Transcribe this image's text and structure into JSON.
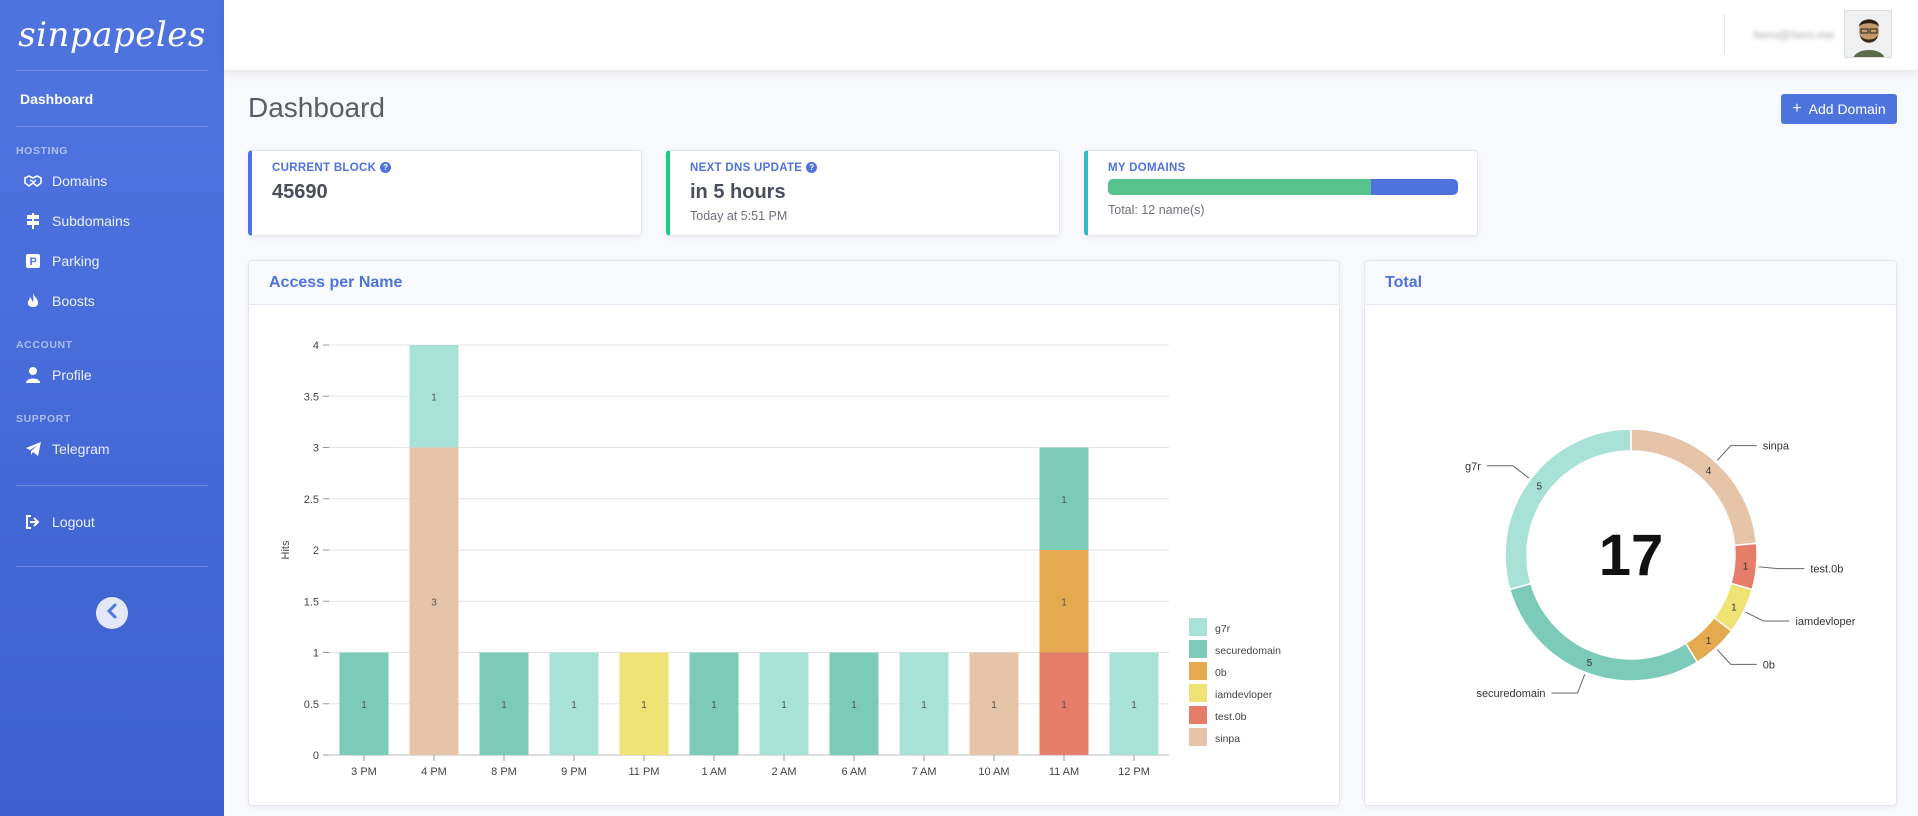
{
  "sidebar": {
    "brand": "sinpapeles",
    "dashboard": "Dashboard",
    "sections": [
      {
        "heading": "HOSTING",
        "items": [
          {
            "label": "Domains",
            "icon": "handshake-icon"
          },
          {
            "label": "Subdomains",
            "icon": "signs-icon"
          },
          {
            "label": "Parking",
            "icon": "parking-icon"
          },
          {
            "label": "Boosts",
            "icon": "flame-icon"
          }
        ]
      },
      {
        "heading": "ACCOUNT",
        "items": [
          {
            "label": "Profile",
            "icon": "user-icon"
          }
        ]
      },
      {
        "heading": "SUPPORT",
        "items": [
          {
            "label": "Telegram",
            "icon": "paper-plane-icon"
          }
        ]
      }
    ],
    "logout": "Logout"
  },
  "topbar": {
    "user": "hero@hero.me"
  },
  "page": {
    "title": "Dashboard",
    "add_button": "Add Domain"
  },
  "stats": {
    "current_block": {
      "label": "CURRENT BLOCK",
      "value": "45690",
      "color": "#4e73df"
    },
    "next_dns": {
      "label": "NEXT DNS UPDATE",
      "value": "in 5 hours",
      "sub": "Today at 5:51 PM",
      "color": "#1cc88a"
    },
    "my_domains": {
      "label": "MY DOMAINS",
      "progress": 0.75,
      "sub": "Total: 12 name(s)",
      "color": "#36b9cc"
    }
  },
  "access_card": {
    "title": "Access per Name"
  },
  "total_card": {
    "title": "Total"
  },
  "chart_data": [
    {
      "type": "bar",
      "stacked": true,
      "ylabel": "Hits",
      "ylim": [
        0,
        4
      ],
      "yticks": [
        "0",
        "0.5",
        "1",
        "1.5",
        "2",
        "2.5",
        "3",
        "3.5",
        "4"
      ],
      "categories": [
        "3 PM",
        "4 PM",
        "8 PM",
        "9 PM",
        "11 PM",
        "1 AM",
        "2 AM",
        "6 AM",
        "7 AM",
        "10 AM",
        "11 AM",
        "12 PM"
      ],
      "legend_position": "right",
      "series": [
        {
          "name": "g7r",
          "color": "#a8e2d6",
          "values": [
            0,
            1,
            0,
            1,
            0,
            0,
            1,
            0,
            1,
            0,
            0,
            1
          ]
        },
        {
          "name": "securedomain",
          "color": "#7ccbb9",
          "values": [
            1,
            0,
            1,
            0,
            0,
            1,
            0,
            1,
            0,
            0,
            1,
            0
          ]
        },
        {
          "name": "0b",
          "color": "#e5aa4f",
          "values": [
            0,
            0,
            0,
            0,
            0,
            0,
            0,
            0,
            0,
            0,
            1,
            0
          ]
        },
        {
          "name": "iamdevloper",
          "color": "#eee374",
          "values": [
            0,
            0,
            0,
            0,
            1,
            0,
            0,
            0,
            0,
            0,
            0,
            0
          ]
        },
        {
          "name": "test.0b",
          "color": "#e67c6a",
          "values": [
            0,
            0,
            0,
            0,
            0,
            0,
            0,
            0,
            0,
            0,
            1,
            0
          ]
        },
        {
          "name": "sinpa",
          "color": "#e5c4a7",
          "values": [
            0,
            3,
            0,
            0,
            0,
            0,
            0,
            0,
            0,
            1,
            0,
            0
          ]
        }
      ]
    },
    {
      "type": "pie",
      "donut": true,
      "center_label": "17",
      "slices": [
        {
          "name": "sinpa",
          "value": 4,
          "color": "#e5c4a7"
        },
        {
          "name": "test.0b",
          "value": 1,
          "color": "#e67c6a"
        },
        {
          "name": "iamdevloper",
          "value": 1,
          "color": "#eee374"
        },
        {
          "name": "0b",
          "value": 1,
          "color": "#e5aa4f"
        },
        {
          "name": "securedomain",
          "value": 5,
          "color": "#7ccbb9"
        },
        {
          "name": "g7r",
          "value": 5,
          "color": "#a8e2d6"
        }
      ]
    }
  ]
}
